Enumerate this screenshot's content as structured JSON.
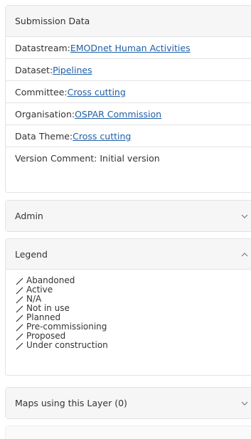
{
  "submission": {
    "header": "Submission Data",
    "datastream_prefix": "Datastream: ",
    "datastream_value": "EMODnet Human Activities",
    "dataset_prefix": "Dataset: ",
    "dataset_value": "Pipelines",
    "committee_prefix": "Committee: ",
    "committee_value": "Cross cutting",
    "organisation_prefix": "Organisation: ",
    "organisation_value": "OSPAR Commission",
    "theme_prefix": "Data Theme: ",
    "theme_value": "Cross cutting",
    "version_comment": "Version Comment: Initial version"
  },
  "admin": {
    "header": "Admin"
  },
  "legend": {
    "header": "Legend",
    "items": [
      "Abandoned",
      "Active",
      "N/A",
      "Not in use",
      "Planned",
      "Pre-commissioning",
      "Proposed",
      "Under construction"
    ]
  },
  "maps": {
    "header": "Maps using this Layer (0)"
  },
  "colors": {
    "border": "#e3e3e3",
    "header_bg": "#f6f6f6",
    "link": "#1f5fa6",
    "text": "#333333"
  },
  "icons": {
    "admin_chevron": "chevron-down-icon",
    "legend_chevron": "chevron-up-icon",
    "maps_chevron": "chevron-down-icon",
    "legend_symbol": "line-icon"
  }
}
